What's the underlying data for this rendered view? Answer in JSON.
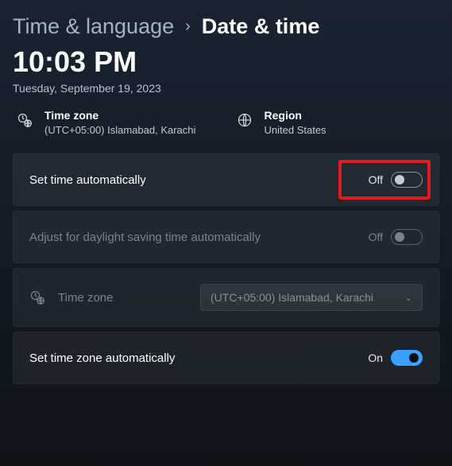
{
  "breadcrumb": {
    "parent": "Time & language",
    "current": "Date & time"
  },
  "clock": "10:03 PM",
  "date": "Tuesday, September 19, 2023",
  "info": {
    "timezone": {
      "label": "Time zone",
      "value": "(UTC+05:00) Islamabad, Karachi"
    },
    "region": {
      "label": "Region",
      "value": "United States"
    }
  },
  "settings": {
    "set_time_auto": {
      "label": "Set time automatically",
      "state": "Off",
      "on": false
    },
    "dst_auto": {
      "label": "Adjust for daylight saving time automatically",
      "state": "Off",
      "on": false,
      "disabled": true
    },
    "tz_select": {
      "label": "Time zone",
      "value": "(UTC+05:00) Islamabad, Karachi",
      "disabled": true
    },
    "set_tz_auto": {
      "label": "Set time zone automatically",
      "state": "On",
      "on": true
    }
  }
}
